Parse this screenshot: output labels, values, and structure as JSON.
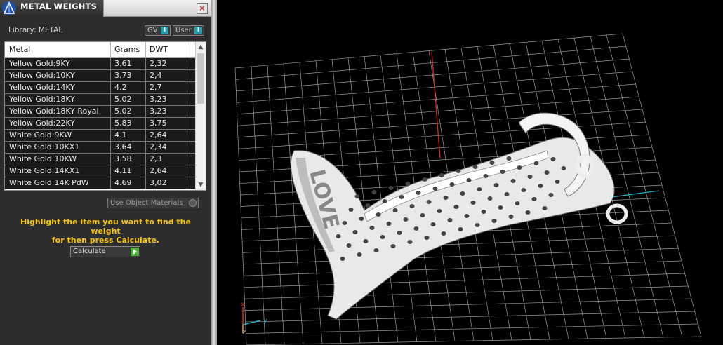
{
  "panel": {
    "title": "METAL WEIGHTS",
    "close_glyph": "✕",
    "library_label": "Library: METAL",
    "toggles": [
      {
        "label": "GV",
        "indicator": "I"
      },
      {
        "label": "User",
        "indicator": "I"
      }
    ],
    "table": {
      "headers": [
        "Metal",
        "Grams",
        "DWT"
      ],
      "rows": [
        [
          "Yellow Gold:9KY",
          "3.61",
          "2,32"
        ],
        [
          "Yellow Gold:10KY",
          "3.73",
          "2,4"
        ],
        [
          "Yellow Gold:14KY",
          "4.2",
          "2,7"
        ],
        [
          "Yellow Gold:18KY",
          "5.02",
          "3,23"
        ],
        [
          "Yellow Gold:18KY Royal",
          "5.02",
          "3,23"
        ],
        [
          "Yellow Gold:22KY",
          "5.83",
          "3,75"
        ],
        [
          "White Gold:9KW",
          "4.1",
          "2,64"
        ],
        [
          "White Gold:10KX1",
          "3.64",
          "2,34"
        ],
        [
          "White Gold:10KW",
          "3.58",
          "2,3"
        ],
        [
          "White Gold:14KX1",
          "4.11",
          "2,64"
        ],
        [
          "White Gold:14K PdW",
          "4.69",
          "3,02"
        ]
      ],
      "scroll_up_glyph": "▲",
      "scroll_down_glyph": "▼"
    },
    "use_object_materials_label": "Use Object Materials",
    "hint_line1": "Highlight the item you want to find the weight",
    "hint_line2": "for then press Calculate.",
    "calculate_label": "Calculate"
  },
  "viewport": {
    "axis_labels": {
      "x": "x",
      "y": "y",
      "z": "z"
    },
    "colors": {
      "x_axis": "#d0301f",
      "y_axis": "#2aa7b8",
      "grid": "#9a9a9a",
      "model": "#f2f2f2",
      "hint": "#f5c320"
    },
    "model_text": "LOVE"
  }
}
